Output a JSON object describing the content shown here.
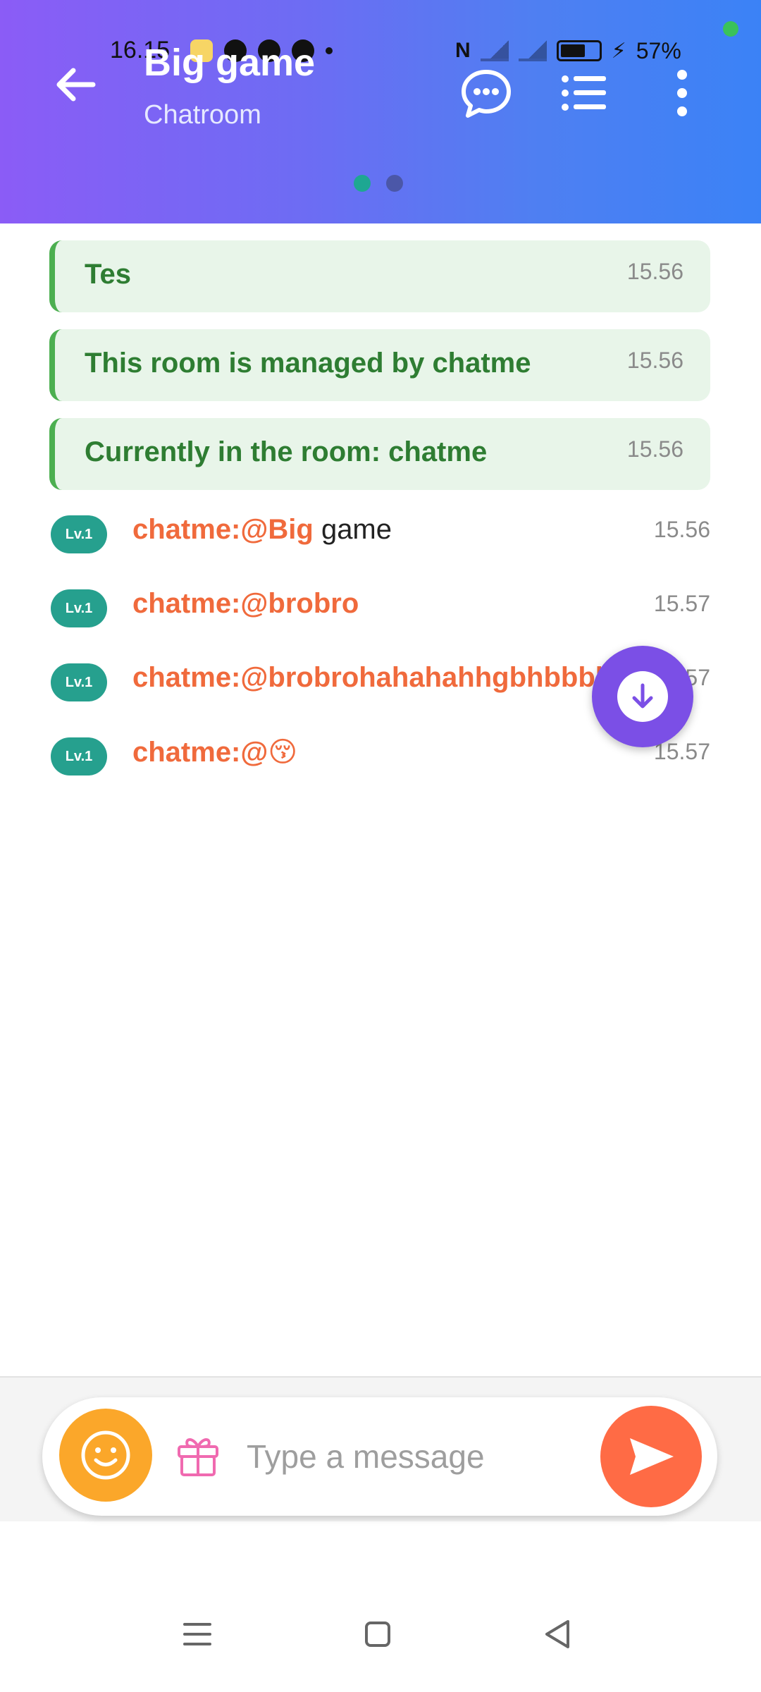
{
  "status_bar": {
    "time": "16.15",
    "battery": "57%"
  },
  "header": {
    "title": "Big game",
    "subtitle": "Chatroom",
    "icons": {
      "back": "arrow-left-icon",
      "chat": "chat-bubble-icon",
      "list": "list-icon",
      "more": "more-vertical-icon"
    },
    "pager_active": 0,
    "pager_count": 2
  },
  "system_messages": [
    {
      "text": "Tes",
      "time": "15.56"
    },
    {
      "text": "This room is managed by chatme",
      "time": "15.56"
    },
    {
      "text": "Currently in the room: chatme",
      "time": "15.56"
    }
  ],
  "chat_messages": [
    {
      "level": "Lv.1",
      "name": "chatme:@Big",
      "body": " game",
      "time": "15.56"
    },
    {
      "level": "Lv.1",
      "name": "chatme:@brobro",
      "body": "",
      "time": "15.57"
    },
    {
      "level": "Lv.1",
      "name": "chatme:@brobrohahahahhgbhbbbb",
      "body": "",
      "time": "15.57"
    },
    {
      "level": "Lv.1",
      "name": "chatme:@😚",
      "body": "",
      "time": "15.57"
    }
  ],
  "composer": {
    "placeholder": "Type a message",
    "value": ""
  },
  "colors": {
    "header_start": "#8b5cf6",
    "header_end": "#3b82f6",
    "system_bg": "#e8f5e9",
    "system_text": "#2e7d32",
    "name_color": "#f06a3c",
    "level_badge": "#26a08e",
    "fab": "#7b4fe6",
    "emoji_btn": "#fba72a",
    "send_btn": "#ff6b45"
  }
}
